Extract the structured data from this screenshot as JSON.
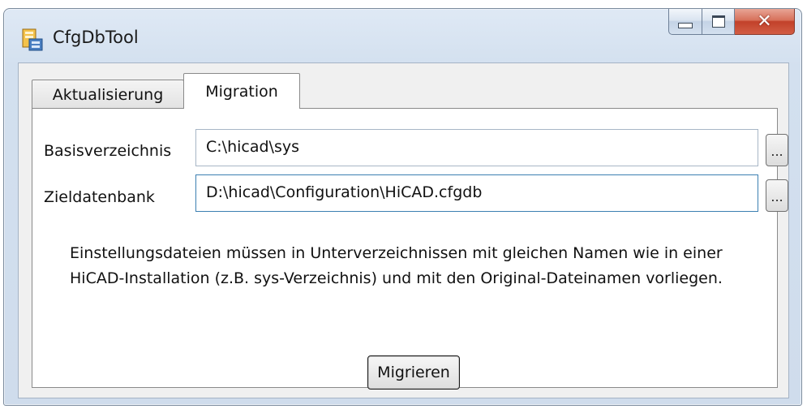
{
  "window": {
    "title": "CfgDbTool",
    "icon": "config-db-app-icon",
    "controls": {
      "minimize": "minimize-icon",
      "maximize": "maximize-icon",
      "close": "close-icon"
    }
  },
  "tabs": [
    {
      "label": "Aktualisierung",
      "active": false
    },
    {
      "label": "Migration",
      "active": true
    }
  ],
  "form": {
    "base_label": "Basisverzeichnis",
    "base_value": "C:\\hicad\\sys",
    "target_label": "Zieldatenbank",
    "target_value": "D:\\hicad\\Configuration\\HiCAD.cfgdb",
    "browse_label": "..."
  },
  "info": "Einstellungsdateien müssen in Unterverzeichnissen mit gleichen Namen wie in einer HiCAD-Installation (z.B. sys-Verzeichnis) und mit den Original-Dateinamen vorliegen.",
  "actions": {
    "migrate_label": "Migrieren"
  }
}
